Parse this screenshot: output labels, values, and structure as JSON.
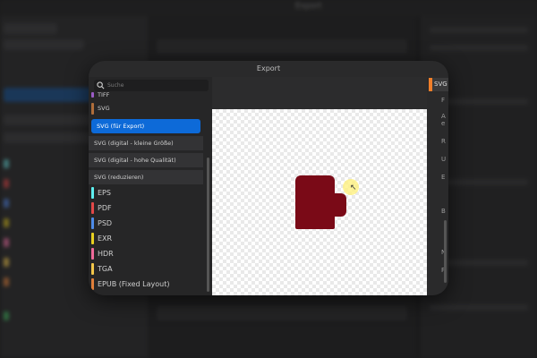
{
  "background": {
    "title": "Export"
  },
  "dialog": {
    "title": "Export",
    "search": {
      "placeholder": "Suche",
      "value": ""
    },
    "formats": [
      {
        "label": "TIFF",
        "swatch": "#9b5cc6",
        "size": "small",
        "state": "partial"
      },
      {
        "label": "SVG",
        "swatch": "#b06d3a",
        "size": "small",
        "state": "normal"
      },
      {
        "label": "SVG (für Export)",
        "swatch": "",
        "size": "small",
        "state": "selected"
      },
      {
        "label": "SVG (digital - kleine Größe)",
        "swatch": "",
        "size": "small",
        "state": "gray"
      },
      {
        "label": "SVG (digital - hohe Qualität)",
        "swatch": "",
        "size": "small",
        "state": "gray"
      },
      {
        "label": "SVG (reduzieren)",
        "swatch": "",
        "size": "small",
        "state": "gray"
      },
      {
        "label": "EPS",
        "swatch": "#5ef0f0",
        "size": "big",
        "state": "normal"
      },
      {
        "label": "PDF",
        "swatch": "#e24848",
        "size": "big",
        "state": "normal"
      },
      {
        "label": "PSD",
        "swatch": "#4d8be8",
        "size": "big",
        "state": "normal"
      },
      {
        "label": "EXR",
        "swatch": "#e8d020",
        "size": "big",
        "state": "normal"
      },
      {
        "label": "HDR",
        "swatch": "#f06a9a",
        "size": "big",
        "state": "normal"
      },
      {
        "label": "TGA",
        "swatch": "#f2c64a",
        "size": "big",
        "state": "normal"
      },
      {
        "label": "EPUB (Fixed Layout)",
        "swatch": "#e07f3a",
        "size": "big",
        "state": "normal"
      }
    ],
    "right_panel": {
      "tab_label": "SVG",
      "glyphs": [
        "F",
        "A",
        "e",
        "R",
        "U",
        "E",
        "B",
        "N",
        "P"
      ]
    },
    "preview": {
      "object": "mug-shape",
      "fill": "#7a0a17"
    }
  },
  "colors": {
    "accent": "#0d6ad8",
    "panel": "#2a2a2b",
    "tab_marker": "#f07f2a"
  }
}
